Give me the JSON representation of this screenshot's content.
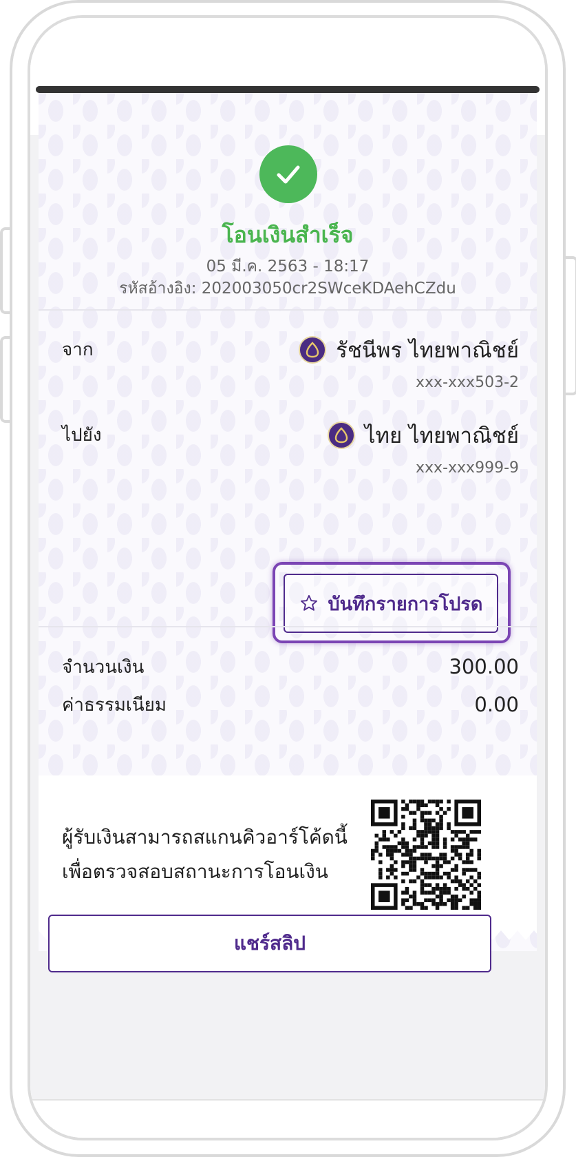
{
  "status": {
    "title": "โอนเงินสำเร็จ",
    "datetime": "05 มี.ค. 2563 - 18:17",
    "reference": "รหัสอ้างอิง: 202003050cr2SWceKDAehCZdu"
  },
  "transfer": {
    "from_label": "จาก",
    "from_name": "รัชนีพร ไทยพาณิชย์",
    "from_account": "xxx-xxx503-2",
    "to_label": "ไปยัง",
    "to_name": "ไทย ไทยพาณิชย์",
    "to_account": "xxx-xxx999-9"
  },
  "favorite": {
    "label": "บันทึกรายการโปรด",
    "icon": "star-outline-icon"
  },
  "amounts": {
    "amount_label": "จำนวนเงิน",
    "amount_value": "300.00",
    "fee_label": "ค่าธรรมเนียม",
    "fee_value": "0.00"
  },
  "qr": {
    "line1": "ผู้รับเงินสามารถสแกนคิวอาร์โค้ดนี้",
    "line2": "เพื่อตรวจสอบสถานะการโอนเงิน"
  },
  "share": {
    "label": "แชร์สลิป"
  },
  "colors": {
    "success": "#4ab54f",
    "brand_purple": "#4f2a8c",
    "highlight": "#7b45b4"
  }
}
